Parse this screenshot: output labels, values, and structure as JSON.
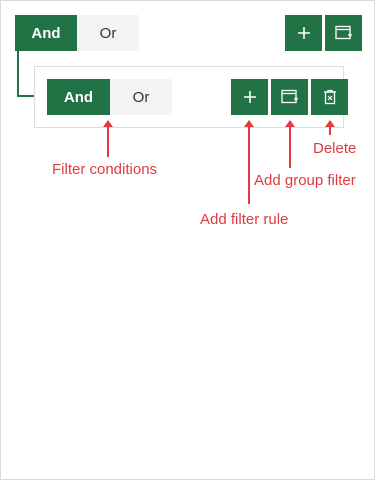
{
  "top_group": {
    "and_label": "And",
    "or_label": "Or"
  },
  "nested_group": {
    "and_label": "And",
    "or_label": "Or"
  },
  "annotations": {
    "filter_conditions": "Filter conditions",
    "add_filter_rule": "Add filter rule",
    "add_group_filter": "Add group filter",
    "delete": "Delete"
  },
  "colors": {
    "accent": "#217346",
    "annotation": "#e13a3f",
    "inactive_button": "#f3f3f3"
  },
  "icons": [
    "plus-icon",
    "add-group-icon",
    "delete-icon"
  ]
}
